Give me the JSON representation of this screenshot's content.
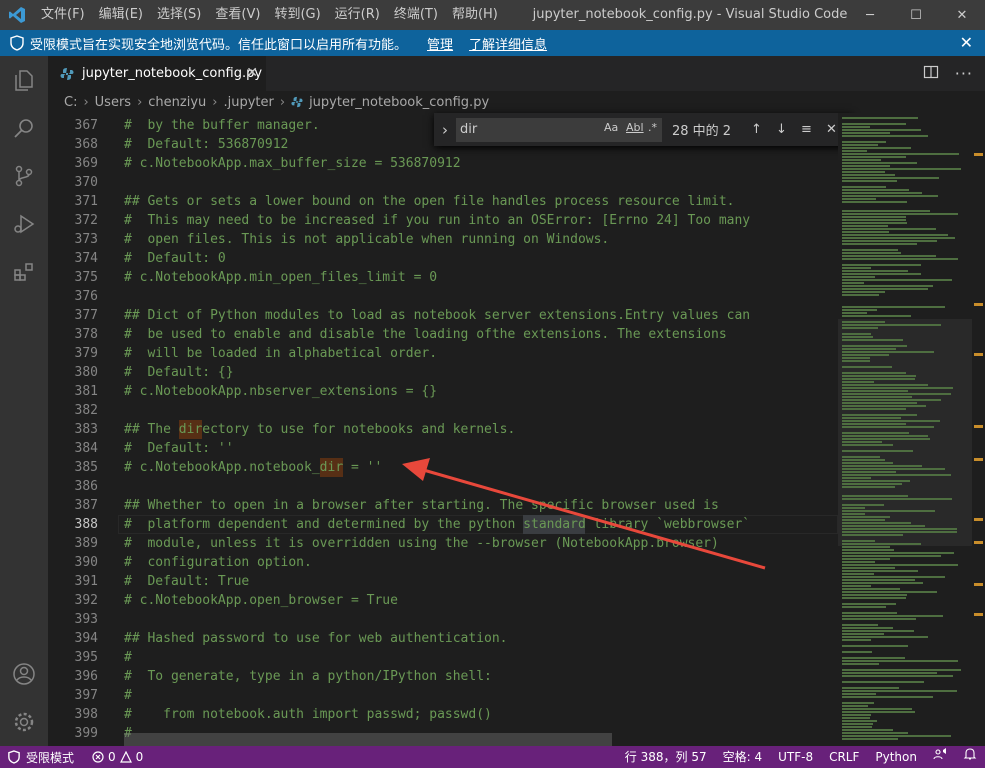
{
  "titlebar": {
    "menu": [
      "文件(F)",
      "编辑(E)",
      "选择(S)",
      "查看(V)",
      "转到(G)",
      "运行(R)",
      "终端(T)",
      "帮助(H)"
    ],
    "title": "jupyter_notebook_config.py - Visual Studio Code",
    "minimize": "─",
    "maximize": "☐",
    "close": "✕"
  },
  "banner": {
    "message": "受限模式旨在实现安全地浏览代码。信任此窗口以启用所有功能。",
    "manage": "管理",
    "learn_more": "了解详细信息",
    "close": "✕"
  },
  "tab": {
    "label": "jupyter_notebook_config.py",
    "close": "✕"
  },
  "breadcrumb": {
    "parts": [
      "C:",
      "Users",
      "chenziyu",
      ".jupyter",
      "jupyter_notebook_config.py"
    ],
    "sep": "›"
  },
  "find": {
    "query": "dir",
    "match_case": "Aa",
    "whole_word": "Abl",
    "regex": ".*",
    "count": "28 中的 2",
    "expand": "›",
    "prev": "↑",
    "next": "↓",
    "selection": "≡",
    "close": "✕"
  },
  "editor": {
    "active_line": 388,
    "lines": [
      {
        "n": "367",
        "t": "#  by the buffer manager."
      },
      {
        "n": "368",
        "t": "#  Default: 536870912"
      },
      {
        "n": "369",
        "t": "# c.NotebookApp.max_buffer_size = 536870912"
      },
      {
        "n": "370",
        "t": ""
      },
      {
        "n": "371",
        "t": "## Gets or sets a lower bound on the open file handles process resource limit."
      },
      {
        "n": "372",
        "t": "#  This may need to be increased if you run into an OSError: [Errno 24] Too many"
      },
      {
        "n": "373",
        "t": "#  open files. This is not applicable when running on Windows."
      },
      {
        "n": "374",
        "t": "#  Default: 0"
      },
      {
        "n": "375",
        "t": "# c.NotebookApp.min_open_files_limit = 0"
      },
      {
        "n": "376",
        "t": ""
      },
      {
        "n": "377",
        "t": "## Dict of Python modules to load as notebook server extensions.Entry values can"
      },
      {
        "n": "378",
        "t": "#  be used to enable and disable the loading ofthe extensions. The extensions"
      },
      {
        "n": "379",
        "t": "#  will be loaded in alphabetical order."
      },
      {
        "n": "380",
        "t": "#  Default: {}"
      },
      {
        "n": "381",
        "t": "# c.NotebookApp.nbserver_extensions = {}"
      },
      {
        "n": "382",
        "t": ""
      },
      {
        "n": "383",
        "t": "## The directory to use for notebooks and kernels."
      },
      {
        "n": "384",
        "t": "#  Default: ''"
      },
      {
        "n": "385",
        "t": "# c.NotebookApp.notebook_dir = ''"
      },
      {
        "n": "386",
        "t": ""
      },
      {
        "n": "387",
        "t": "## Whether to open in a browser after starting. The specific browser used is"
      },
      {
        "n": "388",
        "t": "#  platform dependent and determined by the python standard library `webbrowser`"
      },
      {
        "n": "389",
        "t": "#  module, unless it is overridden using the --browser (NotebookApp.browser)"
      },
      {
        "n": "390",
        "t": "#  configuration option."
      },
      {
        "n": "391",
        "t": "#  Default: True"
      },
      {
        "n": "392",
        "t": "# c.NotebookApp.open_browser = True"
      },
      {
        "n": "393",
        "t": ""
      },
      {
        "n": "394",
        "t": "## Hashed password to use for web authentication."
      },
      {
        "n": "395",
        "t": "#"
      },
      {
        "n": "396",
        "t": "#  To generate, type in a python/IPython shell:"
      },
      {
        "n": "397",
        "t": "#"
      },
      {
        "n": "398",
        "t": "#    from notebook.auth import passwd; passwd()"
      },
      {
        "n": "399",
        "t": "#"
      }
    ]
  },
  "statusbar": {
    "restricted": "受限模式",
    "errors": "0",
    "warnings": "0",
    "position": "行 388，列 57",
    "spaces": "空格: 4",
    "encoding": "UTF-8",
    "eol": "CRLF",
    "language": "Python"
  },
  "colors": {
    "accent": "#0e639c",
    "statusbar": "#68217a",
    "comment": "#6a9955",
    "arrow": "#e8483b",
    "find_highlight": "#613214"
  }
}
